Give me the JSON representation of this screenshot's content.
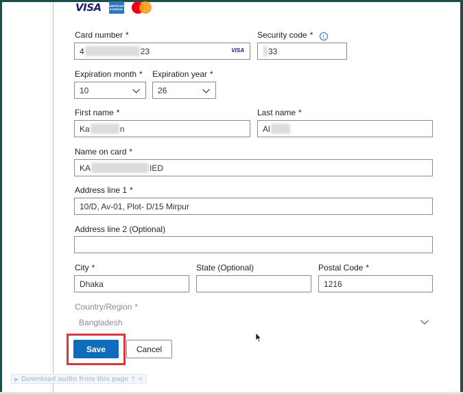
{
  "payment_logos": {
    "visa": "VISA",
    "amex": "AMERICAN EXPRESS",
    "mastercard_icon": "mastercard-icon"
  },
  "form": {
    "card_number": {
      "label": "Card number",
      "required_mark": "*",
      "value_start": "4",
      "value_end": "23",
      "brand": "VISA"
    },
    "security_code": {
      "label": "Security code",
      "required_mark": "*",
      "value_end": "33",
      "info": "i"
    },
    "expiration_month": {
      "label": "Expiration month",
      "required_mark": "*",
      "value": "10"
    },
    "expiration_year": {
      "label": "Expiration year",
      "required_mark": "*",
      "value": "26"
    },
    "first_name": {
      "label": "First name",
      "required_mark": "*",
      "value_start": "Ka",
      "value_end": "n"
    },
    "last_name": {
      "label": "Last name",
      "required_mark": "*",
      "value_start": "Al"
    },
    "name_on_card": {
      "label": "Name on card",
      "required_mark": "*",
      "value_start": "KA",
      "value_end": "IED"
    },
    "address_line1": {
      "label": "Address line 1",
      "required_mark": "*",
      "value": "10/D, Av-01, Plot- D/15 Mirpur"
    },
    "address_line2": {
      "label": "Address line 2 (Optional)",
      "value": ""
    },
    "city": {
      "label": "City",
      "required_mark": "*",
      "value": "Dhaka"
    },
    "state": {
      "label": "State (Optional)",
      "value": ""
    },
    "postal_code": {
      "label": "Postal Code",
      "required_mark": "*",
      "value": "1216"
    },
    "country": {
      "label": "Country/Region",
      "required_mark": "*",
      "value": "Bangladesh"
    }
  },
  "buttons": {
    "save": "Save",
    "cancel": "Cancel"
  },
  "extension_bar": {
    "text": "Download audio from this page",
    "help": "?",
    "close": "✕"
  },
  "colors": {
    "primary": "#0f6cbd",
    "highlight_outline": "#d9363e",
    "frame": "#1b4e4b"
  }
}
